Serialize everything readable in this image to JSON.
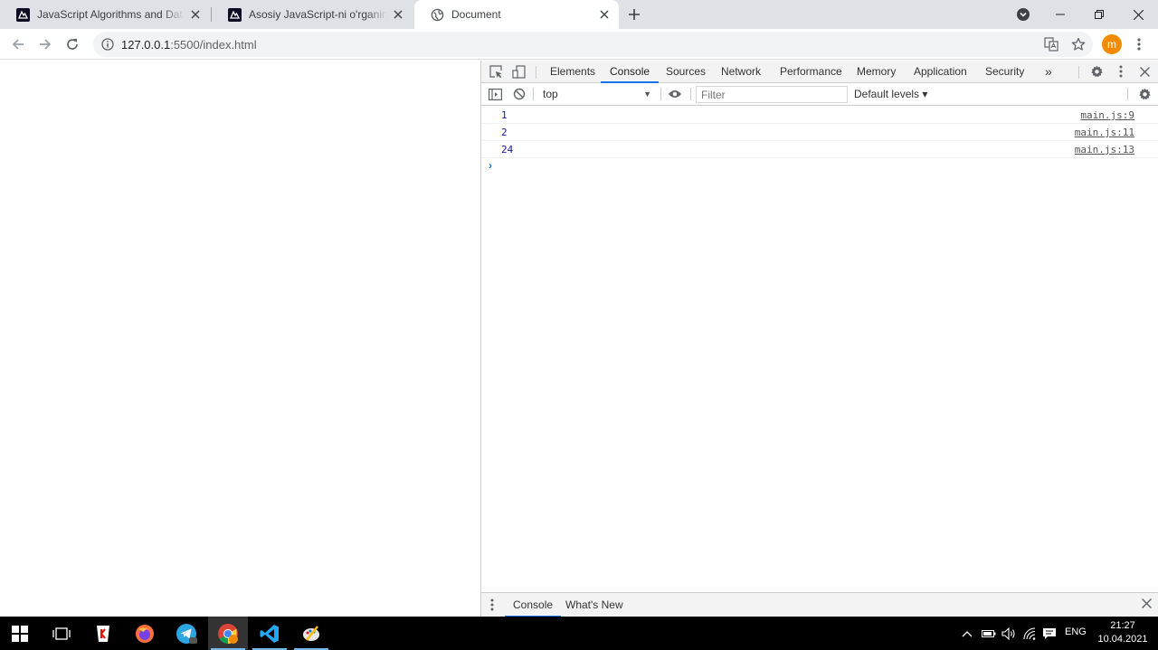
{
  "browser": {
    "tabs": [
      {
        "title": "JavaScript Algorithms and Data Structures",
        "favicon": "freecodecamp-icon"
      },
      {
        "title": "Asosiy JavaScript-ni o'rganing: Recursion",
        "favicon": "freecodecamp-icon"
      },
      {
        "title": "Document",
        "favicon": "globe-icon",
        "active": true
      }
    ],
    "url_host": "127.0.0.1",
    "url_rest": ":5500/index.html",
    "avatar_letter": "m"
  },
  "devtools": {
    "tabs": [
      "Elements",
      "Console",
      "Sources",
      "Network",
      "Performance",
      "Memory",
      "Application",
      "Security"
    ],
    "active_tab": "Console",
    "more": "»",
    "context": "top",
    "filter_placeholder": "Filter",
    "levels": "Default levels ▾",
    "messages": [
      {
        "value": "1",
        "source": "main.js:9"
      },
      {
        "value": "2",
        "source": "main.js:11"
      },
      {
        "value": "24",
        "source": "main.js:13"
      }
    ],
    "prompt": "›",
    "drawer_tabs": [
      "Console",
      "What's New"
    ]
  },
  "taskbar": {
    "language": "ENG",
    "time": "21:27",
    "date": "10.04.2021"
  },
  "colors": {
    "accent": "#1a73e8",
    "console_value": "#1a1aa6",
    "avatar": "#f28b00",
    "taskbar": "#000000"
  }
}
